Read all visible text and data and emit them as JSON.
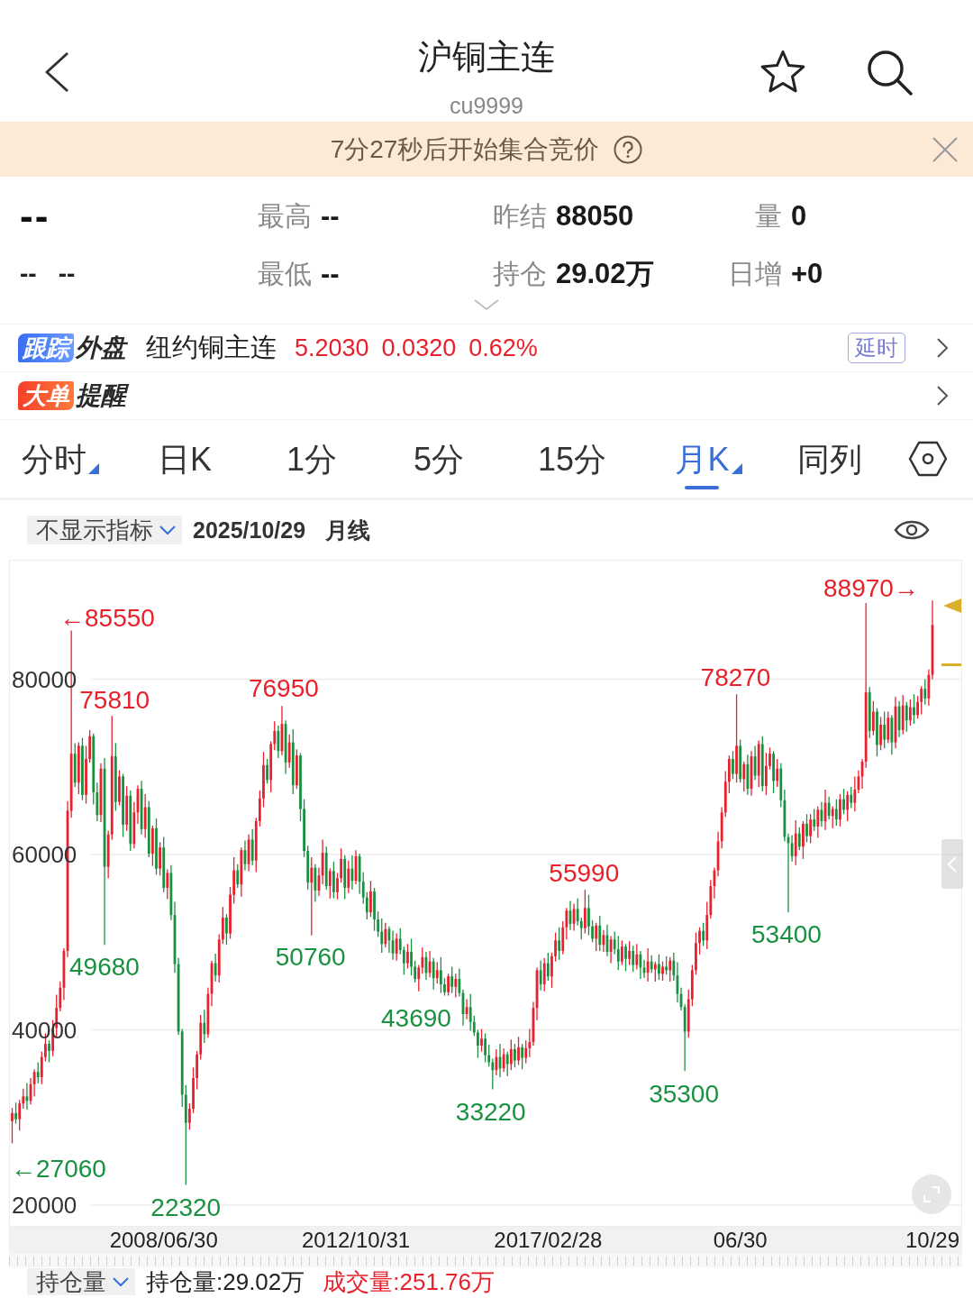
{
  "header": {
    "title": "沪铜主连",
    "code": "cu9999"
  },
  "notice": {
    "text": "7分27秒后开始集合竞价"
  },
  "quote": {
    "rows": [
      {
        "price": "--",
        "stats": [
          {
            "label": "最高",
            "value": "--"
          },
          {
            "label": "昨结",
            "value": "88050"
          },
          {
            "label": "量",
            "value": "0"
          }
        ]
      },
      {
        "change": [
          "--",
          "--"
        ],
        "stats": [
          {
            "label": "最低",
            "value": "--"
          },
          {
            "label": "持仓",
            "value": "29.02万"
          },
          {
            "label": "日增",
            "value": "+0"
          }
        ]
      }
    ]
  },
  "rows": [
    {
      "kind": "tracking",
      "tag": "跟踪",
      "title": "外盘",
      "name": "纽约铜主连",
      "values": [
        "5.2030",
        "0.0320",
        "0.62%"
      ],
      "badge": "延时"
    },
    {
      "kind": "alert",
      "tag": "大单",
      "title": "提醒"
    }
  ],
  "tabs": [
    {
      "label": "分时",
      "selected": false,
      "has_menu": true
    },
    {
      "label": "日K",
      "selected": false,
      "has_menu": false
    },
    {
      "label": "1分",
      "selected": false,
      "has_menu": false
    },
    {
      "label": "5分",
      "selected": false,
      "has_menu": false
    },
    {
      "label": "15分",
      "selected": false,
      "has_menu": false
    },
    {
      "label": "月K",
      "selected": true,
      "has_menu": true
    },
    {
      "label": "同列",
      "selected": false,
      "has_menu": false
    }
  ],
  "chart_bar": {
    "indicator": "不显示指标",
    "date": "2025/10/29",
    "period": "月线"
  },
  "chart": {
    "chart_data": {
      "type": "candlestick",
      "grid": true,
      "ylim": [
        17635,
        93522
      ],
      "yticks": [
        80000,
        60000,
        40000,
        20000
      ],
      "annotations": [
        "88970→",
        "←85550",
        {
          "text": "78270",
          "y": 78270
        },
        {
          "text": "76950",
          "y": 76950
        },
        {
          "text": "75810",
          "y": 75810
        },
        {
          "text": "55990",
          "y": 55990
        },
        {
          "text": "53400",
          "y": 53400
        },
        {
          "text": "49680",
          "y": 49680
        },
        {
          "text": "50760",
          "y": 50760
        },
        "43690",
        {
          "text": "35300",
          "y": 35300
        },
        {
          "text": "33220",
          "y": 33220
        },
        "←27060",
        {
          "text": "22320",
          "y": 22320
        }
      ],
      "categories": [
        null,
        null,
        null,
        null,
        null,
        null,
        null,
        null,
        null,
        null,
        null,
        null,
        null,
        null,
        null,
        null,
        null,
        null,
        null,
        null,
        null,
        null,
        null,
        null,
        null,
        null,
        null,
        null,
        null,
        null,
        null,
        null,
        null,
        null,
        null,
        null,
        null,
        null,
        null,
        null,
        null,
        "2008/06/30",
        null,
        null,
        null,
        null,
        null,
        null,
        null,
        null,
        null,
        null,
        null,
        null,
        null,
        null,
        null,
        null,
        null,
        null,
        null,
        null,
        null,
        null,
        null,
        null,
        null,
        null,
        null,
        null,
        null,
        null,
        null,
        null,
        null,
        null,
        null,
        null,
        null,
        null,
        null,
        null,
        null,
        null,
        null,
        null,
        null,
        null,
        null,
        null,
        null,
        null,
        null,
        "2012/10/31",
        null,
        null,
        null,
        null,
        null,
        null,
        null,
        null,
        null,
        null,
        null,
        null,
        null,
        null,
        null,
        null,
        null,
        null,
        null,
        null,
        null,
        null,
        null,
        null,
        null,
        null,
        null,
        null,
        null,
        null,
        null,
        null,
        null,
        null,
        null,
        null,
        null,
        null,
        null,
        null,
        null,
        null,
        null,
        null,
        null,
        null,
        null,
        null,
        null,
        null,
        null,
        "2017/02/28",
        null,
        null,
        null,
        null,
        null,
        null,
        null,
        null,
        null,
        null,
        null,
        null,
        null,
        null,
        null,
        null,
        null,
        null,
        null,
        null,
        null,
        null,
        null,
        null,
        null,
        null,
        null,
        null,
        null,
        null,
        null,
        null,
        null,
        null,
        null,
        null,
        null,
        null,
        null,
        null,
        null,
        null,
        null,
        null,
        null,
        null,
        null,
        null,
        null,
        null,
        null,
        "06/30",
        null,
        null,
        null,
        null,
        null,
        null,
        null,
        null,
        null,
        null,
        null,
        null,
        null,
        null,
        null,
        null,
        null,
        null,
        null,
        null,
        null,
        null,
        null,
        null,
        null,
        null,
        null,
        null,
        null,
        null,
        null,
        null,
        null,
        null,
        null,
        null,
        null,
        null,
        null,
        null,
        null,
        null,
        null,
        null,
        null,
        null,
        null,
        null,
        null,
        null,
        null,
        "10/29"
      ],
      "ohlc": [
        [
          29600,
          31100,
          27060,
          30500
        ],
        [
          30500,
          31700,
          29300,
          29800
        ],
        [
          29800,
          32000,
          28500,
          31600
        ],
        [
          31600,
          33300,
          31000,
          32400
        ],
        [
          32400,
          33900,
          30900,
          31900
        ],
        [
          31900,
          34500,
          31500,
          33800
        ],
        [
          33800,
          35500,
          32400,
          35200
        ],
        [
          35200,
          36300,
          33900,
          34600
        ],
        [
          34600,
          37500,
          33800,
          36900
        ],
        [
          36900,
          39600,
          36400,
          38400
        ],
        [
          38400,
          38800,
          36300,
          37600
        ],
        [
          37600,
          41100,
          37000,
          40200
        ],
        [
          40200,
          44000,
          39200,
          42500
        ],
        [
          42500,
          45500,
          42100,
          44800
        ],
        [
          44800,
          49300,
          43400,
          49000
        ],
        [
          49000,
          66100,
          48300,
          65000
        ],
        [
          65000,
          85550,
          64200,
          71500
        ],
        [
          71500,
          72700,
          67700,
          68200
        ],
        [
          68200,
          72800,
          66900,
          72400
        ],
        [
          72400,
          73300,
          66200,
          66800
        ],
        [
          66800,
          72400,
          65800,
          70900
        ],
        [
          70900,
          74200,
          70500,
          73500
        ],
        [
          73500,
          73800,
          65700,
          67100
        ],
        [
          67100,
          68200,
          63800,
          64500
        ],
        [
          64500,
          70400,
          63700,
          69800
        ],
        [
          69800,
          71000,
          49680,
          58600
        ],
        [
          58600,
          62700,
          57300,
          62300
        ],
        [
          62300,
          75810,
          61700,
          71200
        ],
        [
          71200,
          72700,
          65000,
          66000
        ],
        [
          66000,
          69600,
          65600,
          68900
        ],
        [
          68900,
          69200,
          62000,
          63400
        ],
        [
          63400,
          67800,
          62700,
          66700
        ],
        [
          66700,
          67300,
          60400,
          61200
        ],
        [
          61200,
          66000,
          60700,
          64800
        ],
        [
          64800,
          67900,
          63500,
          67500
        ],
        [
          67500,
          68400,
          62300,
          62900
        ],
        [
          62900,
          66900,
          61900,
          65400
        ],
        [
          65400,
          66100,
          59700,
          60100
        ],
        [
          60100,
          63300,
          58700,
          63000
        ],
        [
          63000,
          64100,
          57700,
          58400
        ],
        [
          58400,
          61400,
          57600,
          60800
        ],
        [
          60800,
          62000,
          55700,
          56200
        ],
        [
          56200,
          58300,
          54900,
          57900
        ],
        [
          57900,
          58800,
          52500,
          53100
        ],
        [
          53100,
          54600,
          46500,
          47500
        ],
        [
          47500,
          48200,
          39400,
          39800
        ],
        [
          39800,
          40100,
          31200,
          32600
        ],
        [
          32600,
          33700,
          22320,
          29400
        ],
        [
          29400,
          31600,
          28600,
          31000
        ],
        [
          31000,
          35700,
          30500,
          34500
        ],
        [
          34500,
          37600,
          33200,
          37200
        ],
        [
          37200,
          41700,
          36600,
          40800
        ],
        [
          40800,
          42300,
          38500,
          39500
        ],
        [
          39500,
          44800,
          39100,
          44100
        ],
        [
          44100,
          47900,
          42700,
          47600
        ],
        [
          47600,
          48700,
          45500,
          46200
        ],
        [
          46200,
          50900,
          45400,
          50300
        ],
        [
          50300,
          54000,
          49800,
          52800
        ],
        [
          52800,
          53200,
          49700,
          51000
        ],
        [
          51000,
          56300,
          50400,
          55400
        ],
        [
          55400,
          59700,
          54400,
          58200
        ],
        [
          58200,
          58900,
          56200,
          56600
        ],
        [
          56600,
          60800,
          55200,
          60500
        ],
        [
          60500,
          61600,
          58200,
          58900
        ],
        [
          58900,
          62300,
          58100,
          61700
        ],
        [
          61700,
          62900,
          58800,
          59300
        ],
        [
          59300,
          64200,
          58000,
          63800
        ],
        [
          63800,
          67300,
          63200,
          66400
        ],
        [
          66400,
          71700,
          65400,
          70200
        ],
        [
          70200,
          70900,
          68100,
          68500
        ],
        [
          68500,
          72900,
          67100,
          72600
        ],
        [
          72600,
          75200,
          71900,
          74100
        ],
        [
          74100,
          74700,
          71000,
          71800
        ],
        [
          71800,
          76950,
          71300,
          74900
        ],
        [
          74900,
          75300,
          69200,
          70500
        ],
        [
          70500,
          73700,
          69900,
          72800
        ],
        [
          72800,
          74300,
          66900,
          67900
        ],
        [
          67900,
          72000,
          67500,
          71300
        ],
        [
          71300,
          71600,
          63800,
          65200
        ],
        [
          65200,
          66300,
          59700,
          60400
        ],
        [
          60400,
          61000,
          56000,
          56800
        ],
        [
          56800,
          59700,
          50760,
          58500
        ],
        [
          58500,
          58900,
          54600,
          55900
        ],
        [
          55900,
          58500,
          55300,
          57600
        ],
        [
          57600,
          61700,
          56600,
          60200
        ],
        [
          60200,
          60900,
          56000,
          56400
        ],
        [
          56400,
          58400,
          55000,
          58100
        ],
        [
          58100,
          59200,
          55000,
          55700
        ],
        [
          55700,
          57900,
          54900,
          57300
        ],
        [
          57300,
          60700,
          56800,
          59500
        ],
        [
          59500,
          59900,
          54900,
          56200
        ],
        [
          56200,
          59300,
          55600,
          58400
        ],
        [
          58400,
          59900,
          56000,
          57000
        ],
        [
          57000,
          60500,
          56600,
          59800
        ],
        [
          59800,
          60100,
          55500,
          56900
        ],
        [
          56900,
          58000,
          54400,
          55100
        ],
        [
          55100,
          55700,
          52600,
          53400
        ],
        [
          53400,
          57000,
          52900,
          55800
        ],
        [
          55800,
          56200,
          51300,
          52600
        ],
        [
          52600,
          53500,
          50600,
          51200
        ],
        [
          51200,
          52700,
          48800,
          49800
        ],
        [
          49800,
          52200,
          49400,
          51500
        ],
        [
          51500,
          51800,
          48800,
          50200
        ],
        [
          50200,
          51300,
          48000,
          48700
        ],
        [
          48700,
          51000,
          47900,
          50400
        ],
        [
          50400,
          51600,
          48600,
          49100
        ],
        [
          49100,
          49500,
          46300,
          47600
        ],
        [
          47600,
          49800,
          47000,
          48900
        ],
        [
          48900,
          50400,
          46200,
          47200
        ],
        [
          47200,
          47900,
          45400,
          45800
        ],
        [
          45800,
          47400,
          44400,
          47100
        ],
        [
          47100,
          49400,
          46400,
          48300
        ],
        [
          48300,
          48900,
          45700,
          46500
        ],
        [
          46500,
          49000,
          46000,
          47800
        ],
        [
          47800,
          48200,
          44600,
          45900
        ],
        [
          45900,
          47700,
          45300,
          46800
        ],
        [
          46800,
          48300,
          44200,
          45200
        ],
        [
          45200,
          45900,
          43900,
          44300
        ],
        [
          44300,
          46400,
          43900,
          46100
        ],
        [
          46100,
          47200,
          44200,
          44900
        ],
        [
          44900,
          46400,
          43690,
          45800
        ],
        [
          45800,
          47000,
          43800,
          44200
        ],
        [
          44200,
          44600,
          40500,
          41800
        ],
        [
          41800,
          43500,
          41200,
          42600
        ],
        [
          42600,
          44100,
          39900,
          40900
        ],
        [
          40900,
          41600,
          39300,
          39700
        ],
        [
          39700,
          40000,
          36800,
          38200
        ],
        [
          38200,
          40100,
          37500,
          39000
        ],
        [
          39000,
          39600,
          36300,
          37100
        ],
        [
          37100,
          38300,
          35800,
          36300
        ],
        [
          36300,
          36700,
          33220,
          35400
        ],
        [
          35400,
          37800,
          34800,
          36900
        ],
        [
          36900,
          38400,
          34600,
          35600
        ],
        [
          35600,
          37900,
          35200,
          37200
        ],
        [
          37200,
          37500,
          34700,
          36100
        ],
        [
          36100,
          38900,
          35400,
          37800
        ],
        [
          37800,
          38400,
          35700,
          36500
        ],
        [
          36500,
          39200,
          36000,
          38000
        ],
        [
          38000,
          38400,
          35500,
          36800
        ],
        [
          36800,
          38800,
          36200,
          37900
        ],
        [
          37900,
          40100,
          36900,
          38600
        ],
        [
          38600,
          43200,
          38200,
          42500
        ],
        [
          42500,
          47100,
          41100,
          46800
        ],
        [
          46800,
          47900,
          44500,
          45200
        ],
        [
          45200,
          48200,
          44400,
          47600
        ],
        [
          47600,
          48800,
          45600,
          46100
        ],
        [
          46100,
          48800,
          44800,
          48400
        ],
        [
          48400,
          51100,
          47800,
          50200
        ],
        [
          50200,
          51700,
          48000,
          49000
        ],
        [
          49000,
          52400,
          48600,
          51700
        ],
        [
          51700,
          53900,
          50300,
          53600
        ],
        [
          53600,
          54700,
          51400,
          52100
        ],
        [
          52100,
          54400,
          51300,
          53800
        ],
        [
          53800,
          55000,
          51900,
          52400
        ],
        [
          52400,
          52800,
          50300,
          51600
        ],
        [
          51600,
          55990,
          51000,
          53900
        ],
        [
          53900,
          55400,
          50800,
          51800
        ],
        [
          51800,
          52500,
          50000,
          50400
        ],
        [
          50400,
          52200,
          49000,
          51900
        ],
        [
          51900,
          53000,
          49000,
          49700
        ],
        [
          49700,
          51400,
          48900,
          50800
        ],
        [
          50800,
          52000,
          48400,
          48900
        ],
        [
          48900,
          50700,
          47600,
          50300
        ],
        [
          50300,
          51200,
          48600,
          49200
        ],
        [
          49200,
          50700,
          46800,
          47800
        ],
        [
          47800,
          50200,
          47400,
          49500
        ],
        [
          49500,
          49800,
          46700,
          48100
        ],
        [
          48100,
          50100,
          47400,
          49000
        ],
        [
          49000,
          49600,
          46600,
          47400
        ],
        [
          47400,
          49800,
          46900,
          48600
        ],
        [
          48600,
          49000,
          45800,
          47100
        ],
        [
          47100,
          48000,
          45900,
          46500
        ],
        [
          46500,
          49300,
          45500,
          47800
        ],
        [
          47800,
          48500,
          46500,
          46900
        ],
        [
          46900,
          47800,
          45500,
          47500
        ],
        [
          47500,
          48600,
          45700,
          46400
        ],
        [
          46400,
          47800,
          45600,
          47200
        ],
        [
          47200,
          48400,
          46300,
          46800
        ],
        [
          46800,
          48300,
          45500,
          47900
        ],
        [
          47900,
          48800,
          45600,
          46200
        ],
        [
          46200,
          47700,
          43100,
          44100
        ],
        [
          44100,
          44800,
          42200,
          42600
        ],
        [
          42600,
          42900,
          35300,
          39800
        ],
        [
          39800,
          44600,
          39100,
          43500
        ],
        [
          43500,
          47400,
          42700,
          46800
        ],
        [
          46800,
          51100,
          46300,
          49900
        ],
        [
          49900,
          51700,
          48600,
          51300
        ],
        [
          51300,
          52200,
          49600,
          50200
        ],
        [
          50200,
          54600,
          49200,
          53100
        ],
        [
          53100,
          57100,
          52700,
          56400
        ],
        [
          56400,
          58500,
          55000,
          58200
        ],
        [
          58200,
          62600,
          57500,
          61500
        ],
        [
          61500,
          65400,
          60700,
          64800
        ],
        [
          64800,
          69500,
          64300,
          68300
        ],
        [
          68300,
          71300,
          67000,
          70900
        ],
        [
          70900,
          71800,
          68600,
          69200
        ],
        [
          69200,
          78270,
          68200,
          72400
        ],
        [
          72400,
          73100,
          68200,
          68600
        ],
        [
          68600,
          70600,
          67200,
          70300
        ],
        [
          70300,
          71400,
          66800,
          67500
        ],
        [
          67500,
          71800,
          66700,
          71200
        ],
        [
          71200,
          72400,
          68500,
          69000
        ],
        [
          69000,
          73000,
          67700,
          72600
        ],
        [
          72600,
          73500,
          67200,
          67800
        ],
        [
          67800,
          71600,
          66800,
          70100
        ],
        [
          70100,
          72200,
          69700,
          71500
        ],
        [
          71500,
          71800,
          67000,
          68400
        ],
        [
          68400,
          70900,
          67700,
          69800
        ],
        [
          69800,
          70400,
          65400,
          66200
        ],
        [
          66200,
          67400,
          61500,
          62000
        ],
        [
          62000,
          62400,
          53400,
          61300
        ],
        [
          61300,
          62200,
          59200,
          59800
        ],
        [
          59800,
          63900,
          58800,
          62400
        ],
        [
          62400,
          63100,
          60500,
          60900
        ],
        [
          60900,
          63800,
          59500,
          63500
        ],
        [
          63500,
          64600,
          61400,
          62100
        ],
        [
          62100,
          64600,
          61300,
          64000
        ],
        [
          64000,
          65200,
          62700,
          63200
        ],
        [
          63200,
          65500,
          61900,
          65100
        ],
        [
          65100,
          66000,
          63200,
          63800
        ],
        [
          63800,
          67400,
          62800,
          65900
        ],
        [
          65900,
          66600,
          64000,
          64400
        ],
        [
          64400,
          65500,
          63000,
          65200
        ],
        [
          65200,
          66300,
          63300,
          64000
        ],
        [
          64000,
          66900,
          63200,
          66300
        ],
        [
          66300,
          67500,
          64600,
          65100
        ],
        [
          65100,
          67200,
          63800,
          66800
        ],
        [
          66800,
          67700,
          65300,
          65900
        ],
        [
          65900,
          68900,
          64900,
          67400
        ],
        [
          67400,
          69600,
          67000,
          68900
        ],
        [
          68900,
          70900,
          67500,
          70600
        ],
        [
          70600,
          88700,
          69900,
          78500
        ],
        [
          78500,
          79100,
          73300,
          74100
        ],
        [
          74100,
          77500,
          73600,
          76300
        ],
        [
          76300,
          76700,
          71200,
          72500
        ],
        [
          72500,
          75700,
          71900,
          74800
        ],
        [
          74800,
          76300,
          72100,
          73100
        ],
        [
          73100,
          76300,
          72700,
          75600
        ],
        [
          75600,
          75900,
          71400,
          72800
        ],
        [
          72800,
          78000,
          72100,
          76900
        ],
        [
          76900,
          77500,
          73400,
          74200
        ],
        [
          74200,
          78200,
          73700,
          77000
        ],
        [
          77000,
          77400,
          74000,
          75300
        ],
        [
          75300,
          77700,
          74700,
          76800
        ],
        [
          76800,
          78300,
          74900,
          75900
        ],
        [
          75900,
          78100,
          75500,
          77400
        ],
        [
          77400,
          79200,
          76000,
          78900
        ],
        [
          78900,
          80000,
          77100,
          77800
        ],
        [
          77800,
          81100,
          77000,
          80500
        ],
        [
          80500,
          88970,
          80000,
          86200
        ]
      ]
    }
  },
  "footer": {
    "selector": "持仓量",
    "readings": [
      {
        "kind": "open_interest",
        "text": "持仓量:29.02万"
      },
      {
        "kind": "volume",
        "text": "成交量:251.76万"
      }
    ]
  }
}
